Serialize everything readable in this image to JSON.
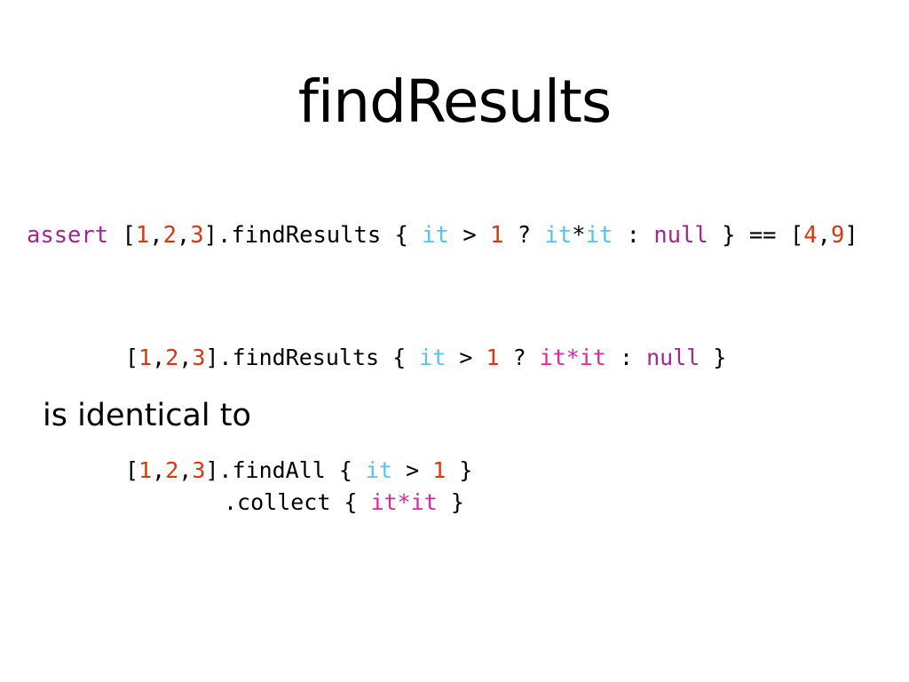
{
  "slide": {
    "title": "findResults"
  },
  "code_line_1": {
    "assert": "assert",
    "open": " [",
    "n1": "1",
    "c1": ",",
    "n2": "2",
    "c2": ",",
    "n3": "3",
    "method": "].findResults { ",
    "it1": "it",
    "gt": " > ",
    "one": "1",
    "q": " ? ",
    "it2": "it",
    "star": "*",
    "it3": "it",
    "colon": " : ",
    "null": "null",
    "close": " } == [",
    "r1": "4",
    "rc": ",",
    "r2": "9",
    "rend": "]"
  },
  "code_line_2": {
    "open": "[",
    "n1": "1",
    "c1": ",",
    "n2": "2",
    "c2": ",",
    "n3": "3",
    "method": "].findResults { ",
    "it1": "it",
    "gt": " > ",
    "one": "1",
    "q": " ? ",
    "expr": "it*it",
    "colon": " : ",
    "null": "null",
    "close": " }"
  },
  "prose": {
    "text": "is identical to"
  },
  "code_line_3": {
    "open": "[",
    "n1": "1",
    "c1": ",",
    "n2": "2",
    "c2": ",",
    "n3": "3",
    "method": "].findAll { ",
    "it1": "it",
    "gt": " > ",
    "one": "1",
    "close": " }"
  },
  "code_line_4": {
    "method": ".collect { ",
    "expr": "it*it",
    "close": " }"
  },
  "colors": {
    "keyword": "#a2288f",
    "number": "#d8380f",
    "it_blue": "#56c3f0",
    "it_pink": "#e2249f"
  }
}
